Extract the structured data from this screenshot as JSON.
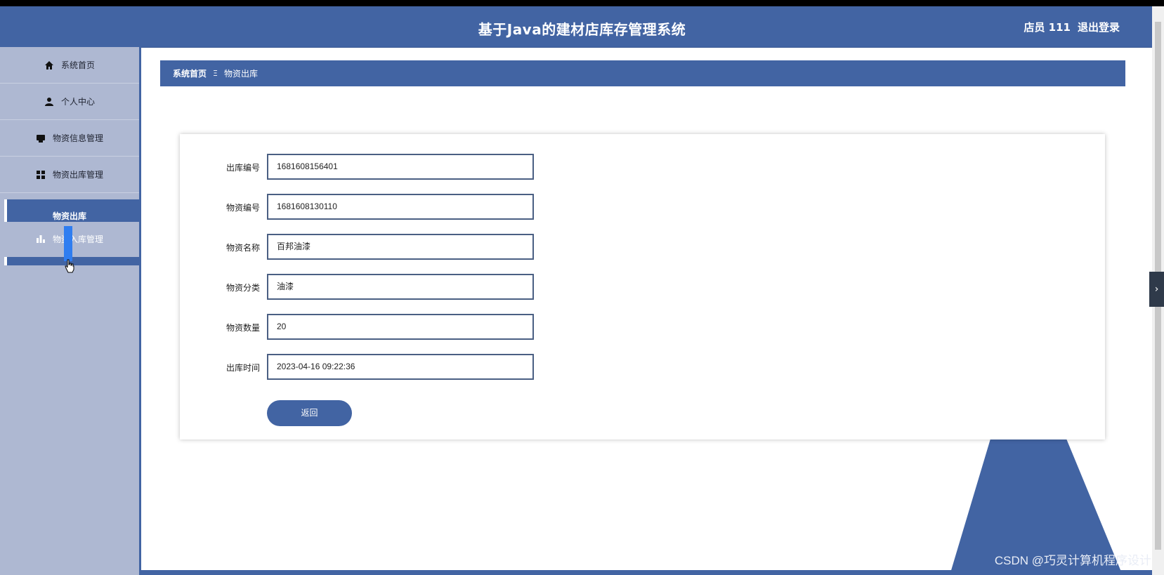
{
  "header": {
    "title": "基于Java的建材店库存管理系统",
    "user": "店员 111",
    "logout": "退出登录"
  },
  "sidebar": {
    "items": [
      {
        "label": "系统首页",
        "icon": "home-icon"
      },
      {
        "label": "个人中心",
        "icon": "user-icon"
      },
      {
        "label": "物资信息管理",
        "icon": "box-icon"
      },
      {
        "label": "物资出库管理",
        "icon": "grid-icon"
      },
      {
        "label": "物资入库管理",
        "icon": "bar-chart-icon"
      }
    ],
    "sub_active": "物资出库"
  },
  "breadcrumb": {
    "home": "系统首页",
    "separator": "Ξ",
    "current": "物资出库"
  },
  "form": {
    "fields": [
      {
        "label": "出库编号",
        "value": "1681608156401"
      },
      {
        "label": "物资编号",
        "value": "1681608130110"
      },
      {
        "label": "物资名称",
        "value": "百邦油漆"
      },
      {
        "label": "物资分类",
        "value": "油漆"
      },
      {
        "label": "物资数量",
        "value": "20"
      },
      {
        "label": "出库时间",
        "value": "2023-04-16 09:22:36"
      }
    ],
    "back_label": "返回"
  },
  "side_toggle": "›",
  "watermark": "CSDN @巧灵计算机程序设计",
  "colors": {
    "primary": "#4264a3",
    "sidebar_bg": "#aeb8d2",
    "hover": "#2f7df0"
  }
}
